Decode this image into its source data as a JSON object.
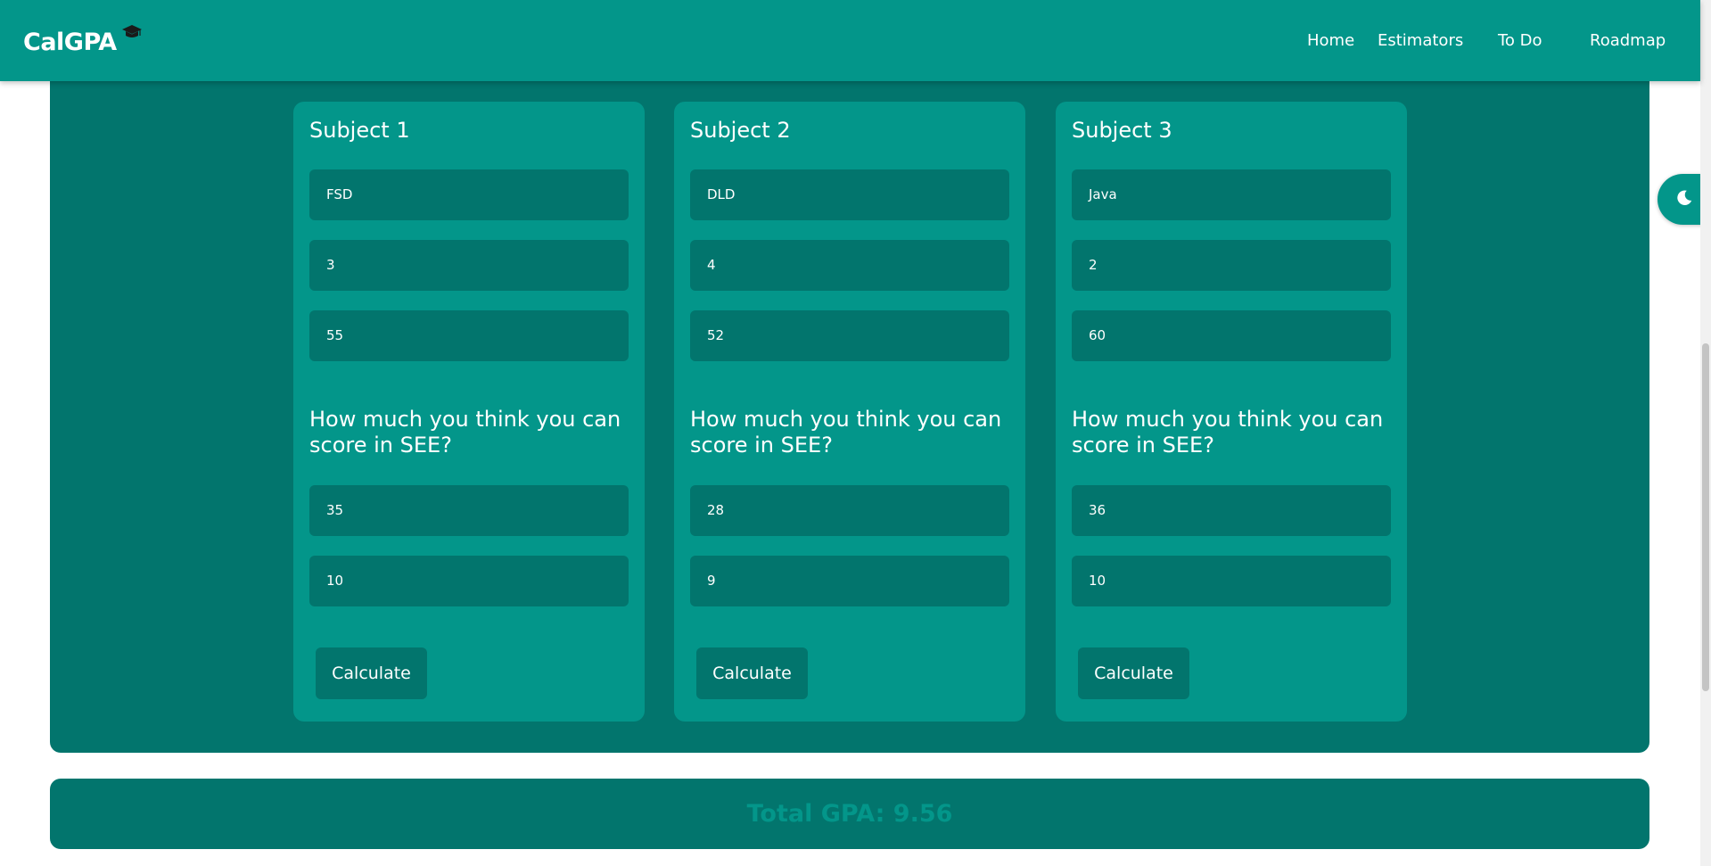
{
  "header": {
    "logo": "CalGPA",
    "cap_icon": "graduation-cap-icon",
    "nav": [
      "Home",
      "Estimators",
      "To Do",
      "Roadmap"
    ]
  },
  "subjects": [
    {
      "title": "Subject 1",
      "name": "FSD",
      "credits": "3",
      "cie": "55",
      "question": "How much you think you can score in SEE?",
      "see": "35",
      "grade": "10",
      "button": "Calculate"
    },
    {
      "title": "Subject 2",
      "name": "DLD",
      "credits": "4",
      "cie": "52",
      "question": "How much you think you can score in SEE?",
      "see": "28",
      "grade": "9",
      "button": "Calculate"
    },
    {
      "title": "Subject 3",
      "name": "Java",
      "credits": "2",
      "cie": "60",
      "question": "How much you think you can score in SEE?",
      "see": "36",
      "grade": "10",
      "button": "Calculate"
    }
  ],
  "total": {
    "label": "Total GPA: 9.56"
  },
  "theme_toggle_icon": "moon-icon",
  "colors": {
    "primary": "#03968a",
    "dark": "#02756d",
    "text": "#ffffff"
  }
}
